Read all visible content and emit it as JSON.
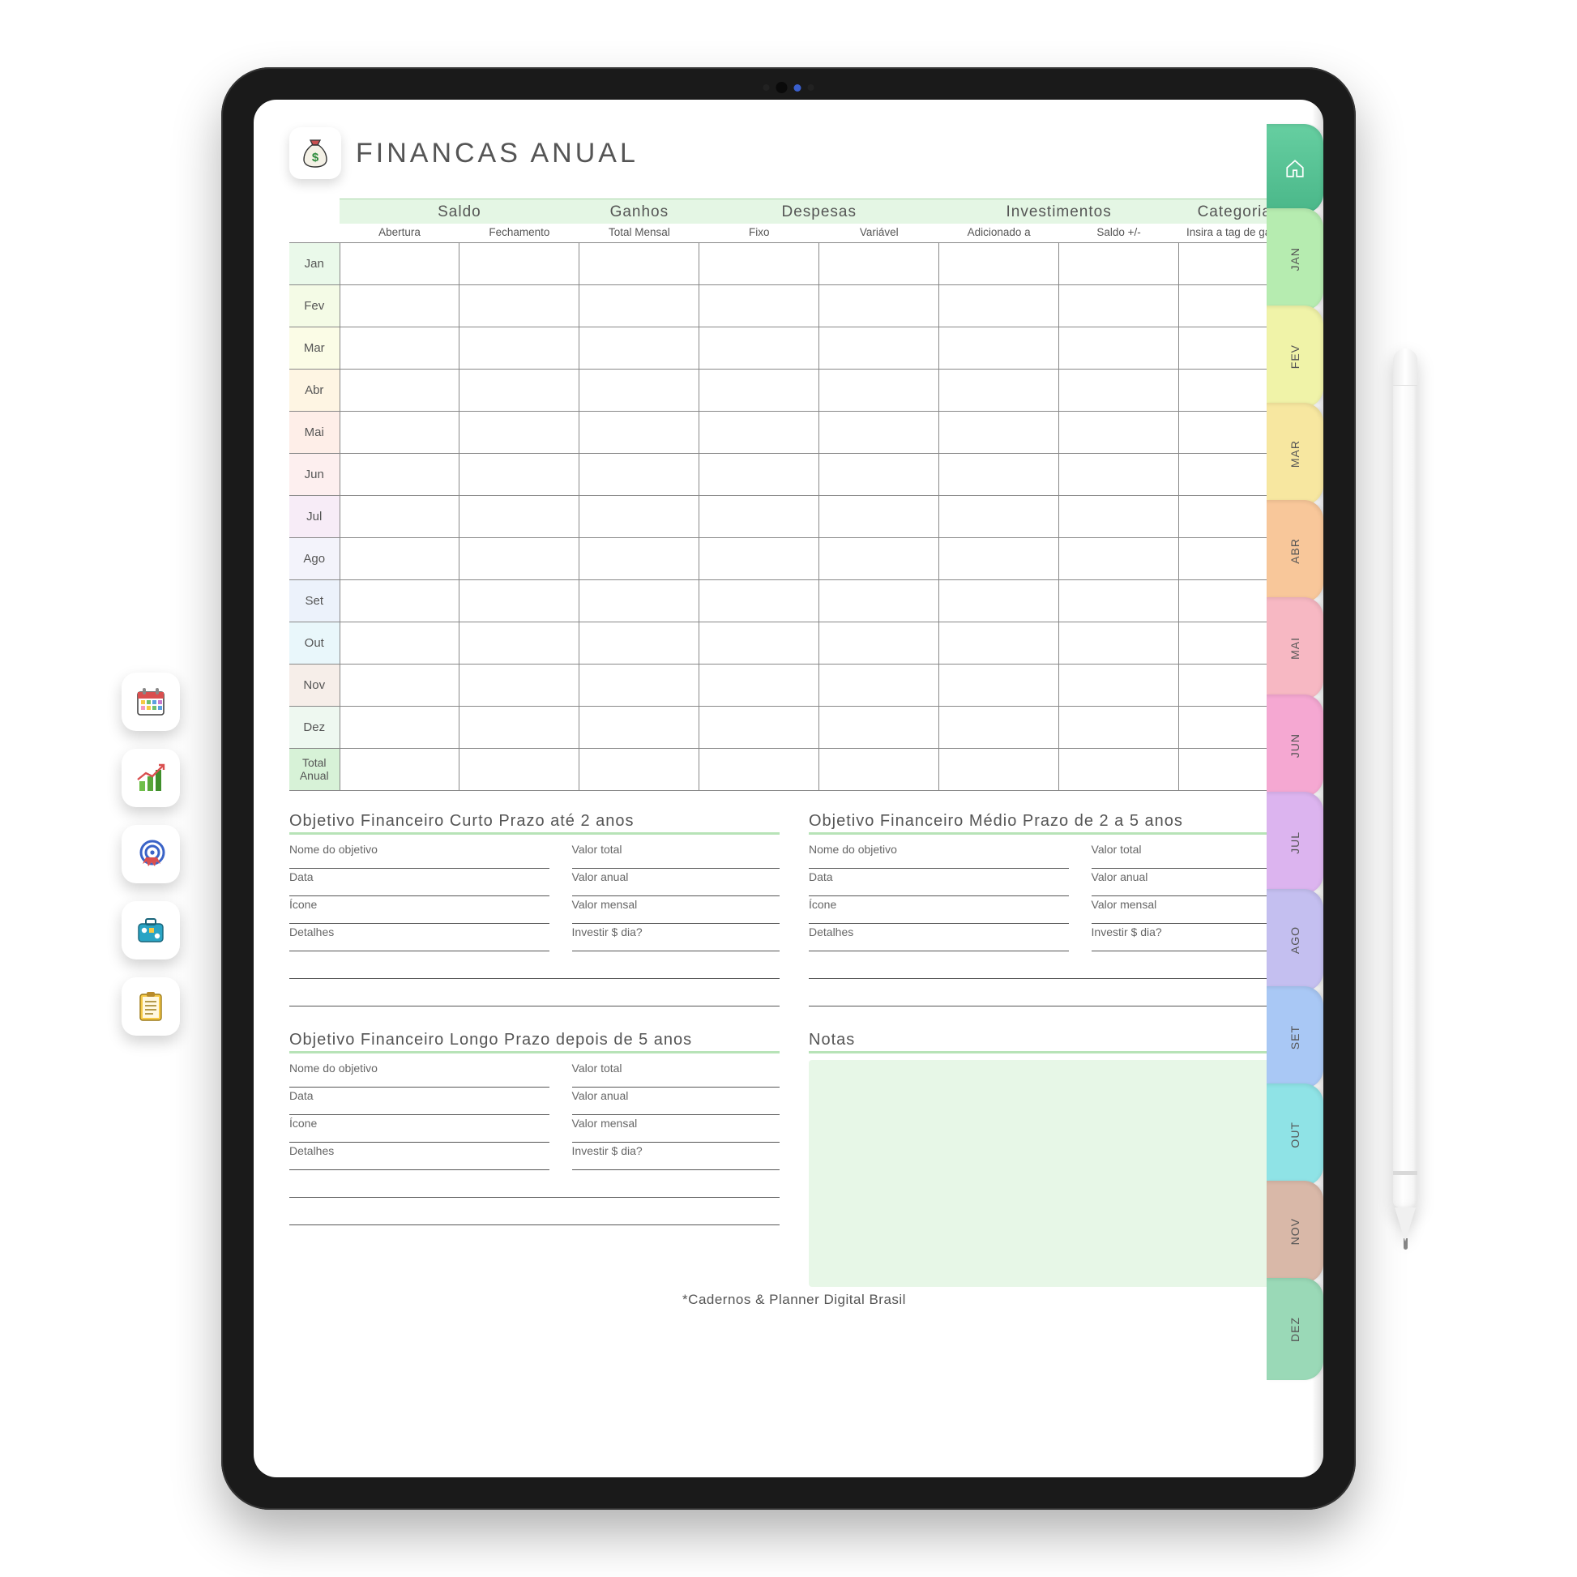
{
  "page": {
    "title": "FINANCAS ANUAL",
    "footer": "*Cadernos & Planner Digital Brasil"
  },
  "table": {
    "groups": {
      "saldo": "Saldo",
      "ganhos": "Ganhos",
      "despesas": "Despesas",
      "investimentos": "Investimentos",
      "categorias": "Categorias"
    },
    "subs": {
      "abertura": "Abertura",
      "fechamento": "Fechamento",
      "total_mensal": "Total Mensal",
      "fixo": "Fixo",
      "variavel": "Variável",
      "adicionado": "Adicionado a",
      "saldo_pm": "Saldo +/-",
      "cat_hint": "Insira a tag de gastos"
    },
    "months": [
      "Jan",
      "Fev",
      "Mar",
      "Abr",
      "Mai",
      "Jun",
      "Jul",
      "Ago",
      "Set",
      "Out",
      "Nov",
      "Dez"
    ],
    "total_label": "Total\nAnual"
  },
  "goals": {
    "short": {
      "title": "Objetivo Financeiro Curto Prazo até 2 anos"
    },
    "mid": {
      "title": "Objetivo Financeiro Médio Prazo de 2 a 5 anos"
    },
    "long": {
      "title": "Objetivo Financeiro Longo Prazo depois de 5 anos"
    },
    "labels": {
      "nome": "Nome do objetivo",
      "valor_total": "Valor total",
      "data": "Data",
      "valor_anual": "Valor anual",
      "icone": "Ícone",
      "valor_mensal": "Valor mensal",
      "detalhes": "Detalhes",
      "investir": "Investir $ dia?"
    }
  },
  "notes": {
    "title": "Notas"
  },
  "side_tabs": [
    "JAN",
    "FEV",
    "MAR",
    "ABR",
    "MAI",
    "JUN",
    "JUL",
    "AGO",
    "SET",
    "OUT",
    "NOV",
    "DEZ"
  ],
  "toolbar": {
    "calendar": "calendar-icon",
    "growth": "growth-chart-icon",
    "target": "target-star-icon",
    "travel": "suitcase-icon",
    "checklist": "checklist-icon"
  },
  "colors": {
    "accent_green": "#b7e3b7",
    "header_green": "#e4f6e4"
  }
}
